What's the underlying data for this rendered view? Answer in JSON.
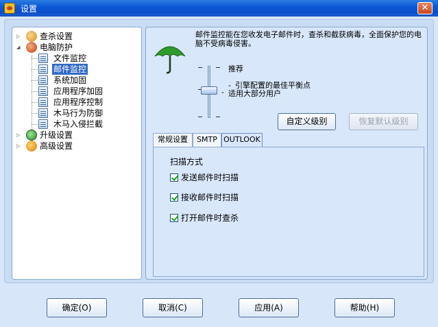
{
  "window": {
    "title": "设置"
  },
  "tree": {
    "items": [
      {
        "label": "查杀设置",
        "icon": "search-magnifier-icon"
      },
      {
        "label": "电脑防护",
        "icon": "shield-hand-icon"
      },
      {
        "label": "文件监控",
        "child": true
      },
      {
        "label": "邮件监控",
        "child": true,
        "selected": true
      },
      {
        "label": "系统加固",
        "child": true
      },
      {
        "label": "应用程序加固",
        "child": true
      },
      {
        "label": "应用程序控制",
        "child": true
      },
      {
        "label": "木马行为防御",
        "child": true
      },
      {
        "label": "木马入侵拦截",
        "child": true
      },
      {
        "label": "升级设置",
        "icon": "upgrade-globe-icon"
      },
      {
        "label": "高级设置",
        "icon": "gear-icon"
      }
    ]
  },
  "panel": {
    "description": "邮件监控能在您收发电子邮件时，查杀和截获病毒，全面保护您的电脑不受病毒侵害。",
    "level": {
      "recommended": "推荐",
      "line1": "引擎配置的最佳平衡点",
      "line2": "适用大部分用户",
      "dash": "-"
    },
    "buttons": {
      "custom": "自定义级别",
      "restore": "恢复默认级别"
    },
    "tabs": [
      "常规设置",
      "SMTP",
      "OUTLOOK"
    ],
    "active_tab": "OUTLOOK",
    "scan_group": "扫描方式",
    "options": [
      {
        "label": "发送邮件时扫描",
        "checked": true
      },
      {
        "label": "接收邮件时扫描",
        "checked": true
      },
      {
        "label": "打开邮件时查杀",
        "checked": true
      }
    ]
  },
  "footer": {
    "ok": "确定(O)",
    "cancel": "取消(C)",
    "apply": "应用(A)",
    "help": "帮助(H)"
  }
}
